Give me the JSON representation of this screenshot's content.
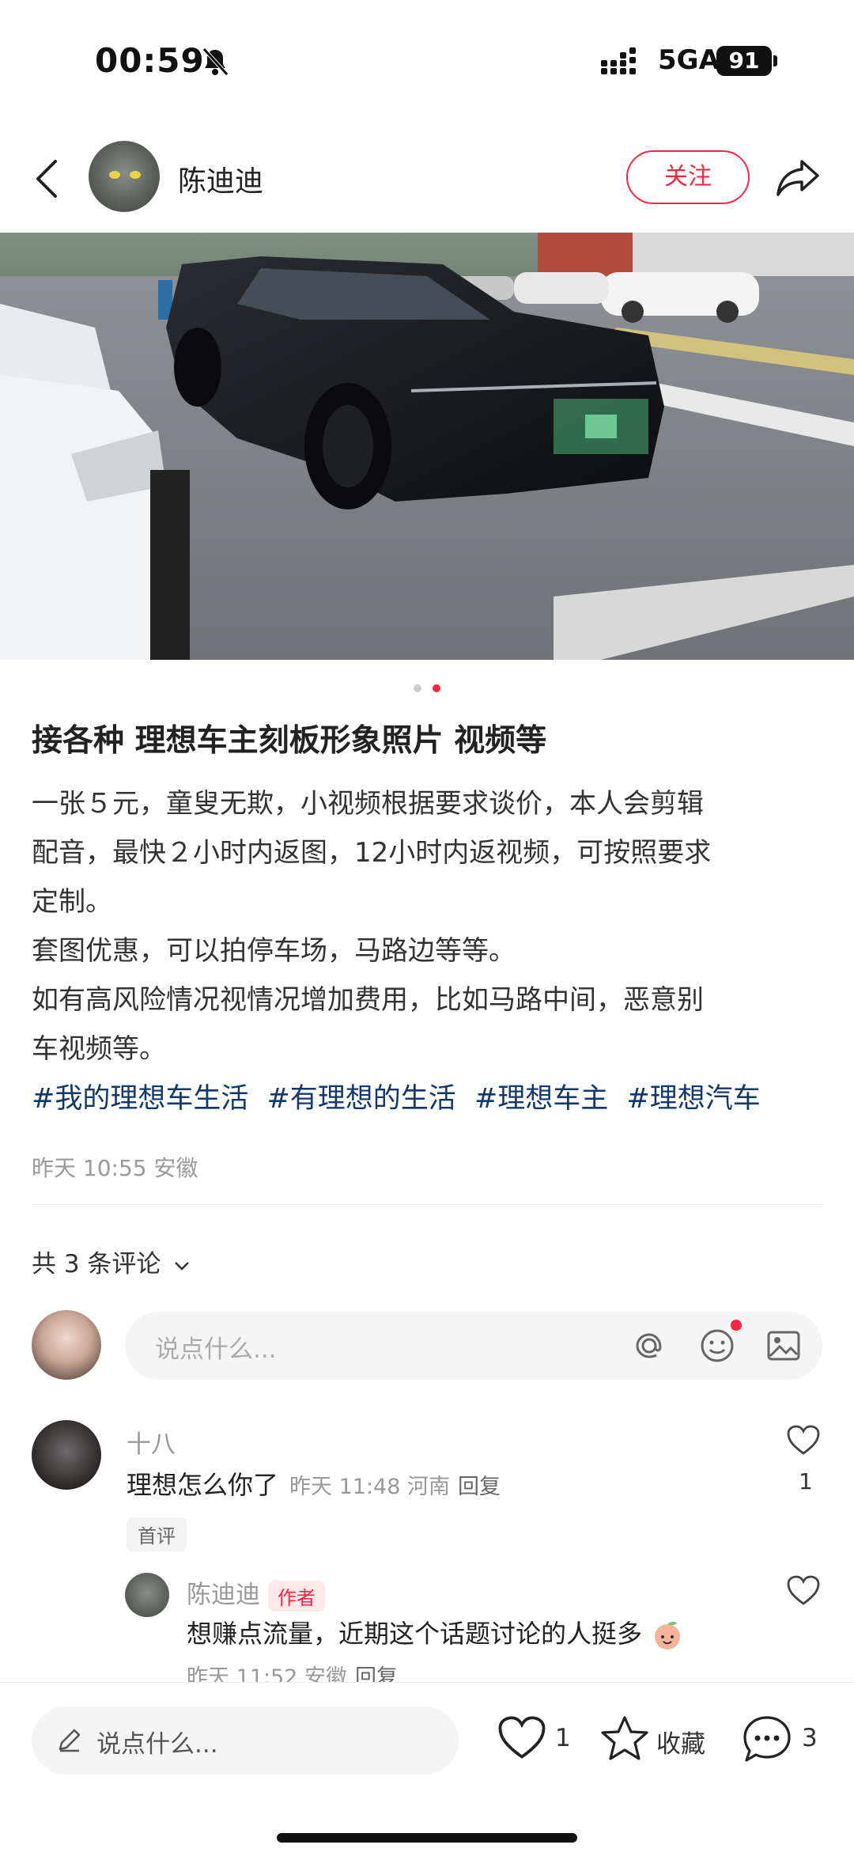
{
  "status_bar": {
    "time": "00:59",
    "network": "5GA",
    "battery": "91",
    "icons": [
      "bell-mute-icon",
      "signal-icon",
      "battery-icon"
    ]
  },
  "header": {
    "username": "陈迪迪",
    "follow_label": "关注",
    "icons": [
      "back-chevron-icon",
      "share-arrow-icon"
    ]
  },
  "gallery": {
    "current": 2,
    "total": 2
  },
  "post": {
    "title": "接各种 理想车主刻板形象照片 视频等",
    "body_lines": [
      "一张５元，童叟无欺，小视频根据要求谈价，本人会剪辑",
      "配音，最快２小时内返图，12小时内返视频，可按照要求",
      "定制。",
      "套图优惠，可以拍停车场，马路边等等。",
      "如有高风险情况视情况增加费用，比如马路中间，恶意别",
      "车视频等。"
    ],
    "tags": [
      "#我的理想车生活",
      "#有理想的生活",
      "#理想车主",
      "#理想汽车"
    ],
    "meta": "昨天 10:55 安徽"
  },
  "comments": {
    "count_label": "共 3 条评论",
    "input_placeholder": "说点什么...",
    "items": [
      {
        "user": "十八",
        "text": "理想怎么你了",
        "meta": "昨天 11:48 河南",
        "reply_label": "回复",
        "likes": "1",
        "badge": "首评"
      }
    ],
    "replies": [
      {
        "user": "陈迪迪",
        "author_badge": "作者",
        "text": "想赚点流量，近期这个话题讨论的人挺多",
        "emoji": "peach-face-emoji",
        "meta": "昨天 11:52 安徽",
        "reply_label": "回复"
      }
    ]
  },
  "bottom_bar": {
    "input_placeholder": "说点什么...",
    "like_count": "1",
    "collect_label": "收藏",
    "comment_count": "3"
  },
  "colors": {
    "accent": "#ff2442",
    "tag": "#13386c",
    "muted": "#999999"
  }
}
